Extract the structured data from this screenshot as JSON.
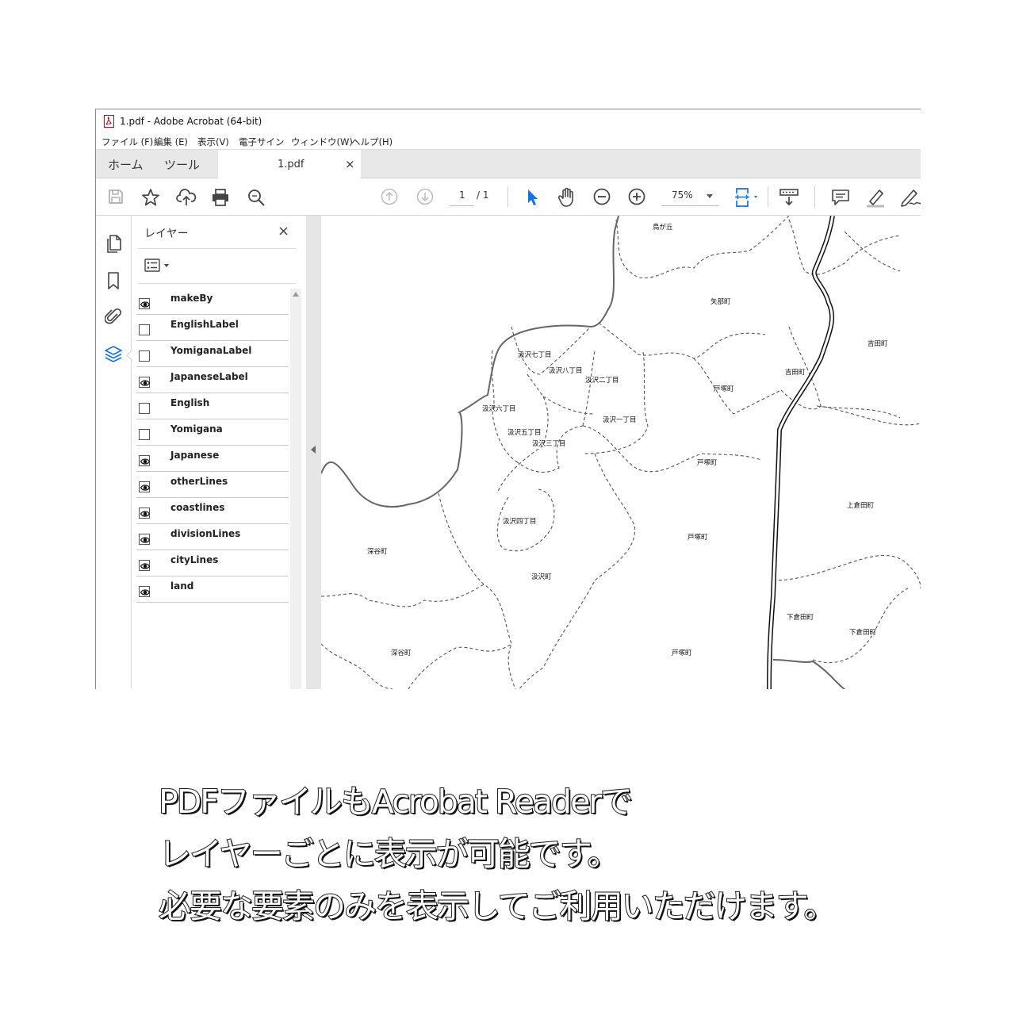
{
  "window": {
    "title": "1.pdf - Adobe Acrobat (64-bit)"
  },
  "menubar": {
    "items": [
      "ファイル (F)",
      "編集 (E)",
      "表示(V)",
      "電子サイン",
      "ウィンドウ(W)",
      "ヘルプ(H)"
    ]
  },
  "tabs": {
    "home": "ホーム",
    "tools": "ツール",
    "document": "1.pdf",
    "close": "×"
  },
  "toolbar": {
    "page_current": "1",
    "page_total": "/ 1",
    "zoom": "75%",
    "icons": [
      "save-icon",
      "star-icon",
      "upload-icon",
      "print-icon",
      "search-icon",
      "prev-page-icon",
      "next-page-icon",
      "select-icon",
      "hand-icon",
      "zoom-out-icon",
      "zoom-in-icon",
      "fit-page-icon",
      "scroll-mode-icon",
      "comment-icon",
      "highlight-icon",
      "sign-icon"
    ],
    "accent": "#1473e6"
  },
  "left_rail": {
    "icons": [
      "pages-icon",
      "bookmark-icon",
      "attachment-icon",
      "layers-icon"
    ]
  },
  "layers_panel": {
    "title": "レイヤー",
    "close": "×",
    "layers": [
      {
        "name": "makeBy",
        "visible": true
      },
      {
        "name": "EnglishLabel",
        "visible": false
      },
      {
        "name": "YomiganaLabel",
        "visible": false
      },
      {
        "name": "JapaneseLabel",
        "visible": true
      },
      {
        "name": "English",
        "visible": false
      },
      {
        "name": "Yomigana",
        "visible": false
      },
      {
        "name": "Japanese",
        "visible": true
      },
      {
        "name": "otherLines",
        "visible": true
      },
      {
        "name": "coastlines",
        "visible": true
      },
      {
        "name": "divisionLines",
        "visible": true
      },
      {
        "name": "cityLines",
        "visible": true
      },
      {
        "name": "land",
        "visible": true
      }
    ]
  },
  "map": {
    "labels": [
      "鳥が丘",
      "矢部町",
      "吉田町",
      "汲沢七丁目",
      "汲沢八丁目",
      "汲沢二丁目",
      "吉田町",
      "戸塚町",
      "汲沢六丁目",
      "汲沢一丁目",
      "汲沢五丁目",
      "汲沢三丁目",
      "戸塚町",
      "上倉田町",
      "汲沢四丁目",
      "戸塚町",
      "深谷町",
      "汲沢町",
      "下倉田町",
      "下倉田町",
      "深谷町",
      "戸塚町"
    ]
  },
  "caption": {
    "lines": [
      "PDFファイルもAcrobat Readerで",
      "レイヤーごとに表示が可能です。",
      "必要な要素のみを表示してご利用いただけます。"
    ]
  }
}
